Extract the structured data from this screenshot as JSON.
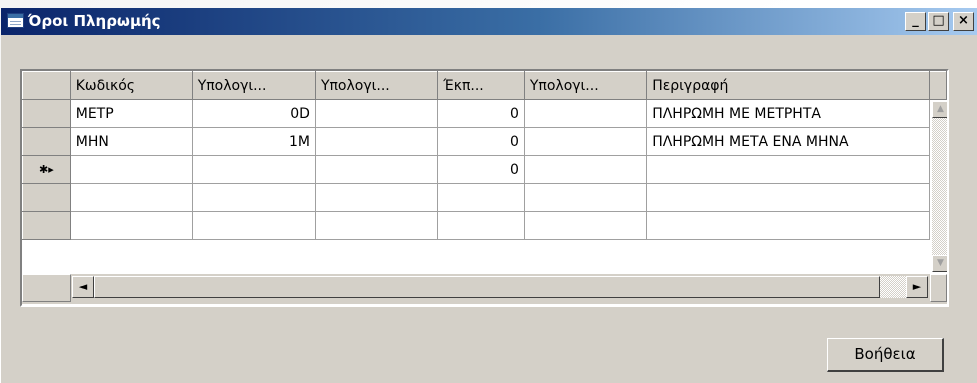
{
  "window": {
    "title": "Όροι Πληρωμής",
    "minimize_label": "_",
    "maximize_label": "□",
    "close_label": "×"
  },
  "grid": {
    "columns": [
      "Κωδικός",
      "Υπολογι...",
      "Υπολογι...",
      "Έκπ...",
      "Υπολογι...",
      "Περιγραφή"
    ],
    "rows": [
      {
        "marker": "",
        "cells": [
          "ΜΕΤΡ",
          "0D",
          "",
          "0",
          "",
          "ΠΛΗΡΩΜΗ ΜΕ ΜΕΤΡΗΤΑ"
        ]
      },
      {
        "marker": "",
        "cells": [
          "ΜΗΝ",
          "1M",
          "",
          "0",
          "",
          "ΠΛΗΡΩΜΗ ΜΕΤΑ ΕΝΑ ΜΗΝΑ"
        ]
      },
      {
        "marker": "✱▸",
        "cells": [
          "",
          "",
          "",
          "0",
          "",
          ""
        ]
      },
      {
        "marker": "",
        "cells": [
          "",
          "",
          "",
          "",
          "",
          ""
        ]
      },
      {
        "marker": "",
        "cells": [
          "",
          "",
          "",
          "",
          "",
          ""
        ]
      }
    ]
  },
  "icons": {
    "app": "table-icon",
    "scroll_left": "◄",
    "scroll_right": "►",
    "scroll_up": "▲",
    "scroll_down": "▼"
  },
  "buttons": {
    "help_label": "Βοήθεια"
  }
}
